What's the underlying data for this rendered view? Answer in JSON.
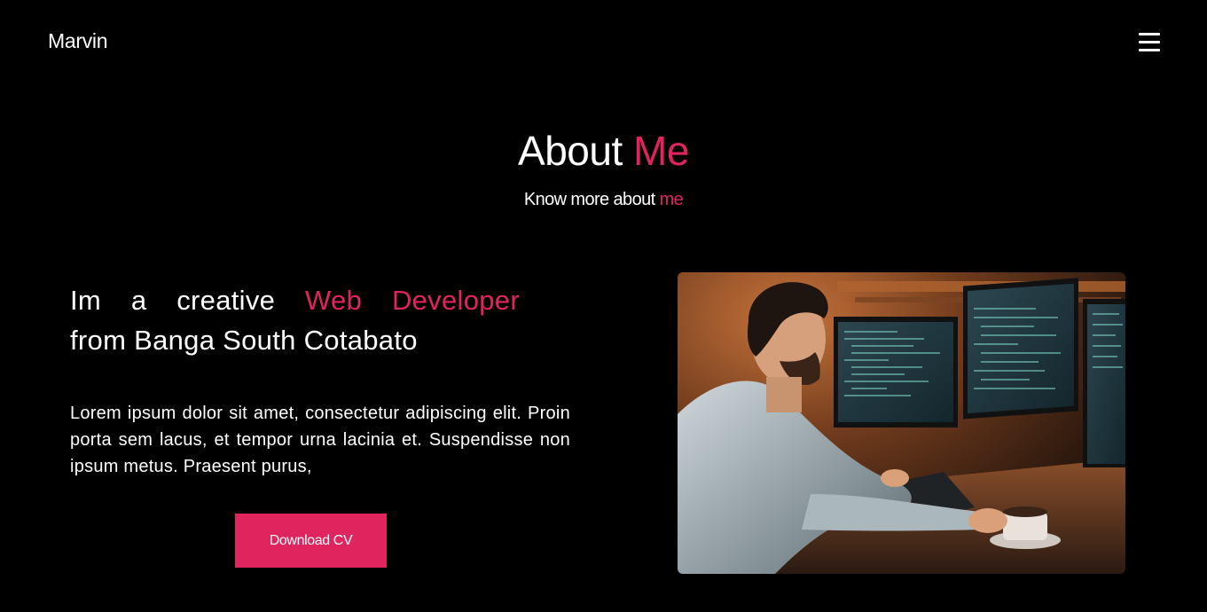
{
  "header": {
    "brand": "Marvin",
    "menu_icon": "hamburger-menu-icon"
  },
  "about": {
    "title_part1": "About",
    "title_part2": "Me",
    "subtitle_part1": "Know more about",
    "subtitle_part2": "me"
  },
  "intro": {
    "w1": "Im",
    "w2": "a",
    "w3": "creative",
    "w4": "Web",
    "w5": "Developer",
    "line2": "from Banga South Cotabato",
    "paragraph": "Lorem ipsum dolor sit amet, consectetur adipiscing elit. Proin porta sem lacus, et tempor urna lacinia et. Suspendisse non ipsum metus. Praesent purus,"
  },
  "cta": {
    "download_label": "Download CV"
  },
  "colors": {
    "background": "#000000",
    "accent": "#e0245e",
    "text": "#ffffff"
  }
}
